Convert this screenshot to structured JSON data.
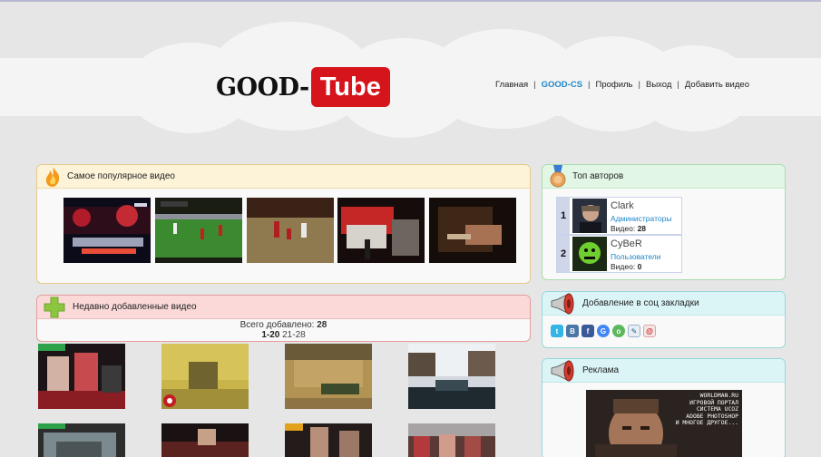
{
  "logo": {
    "part1": "GOOD-",
    "part2": "Tube"
  },
  "nav": [
    {
      "label": "Главная",
      "accent": false
    },
    {
      "label": "GOOD-CS",
      "accent": true
    },
    {
      "label": "Профиль",
      "accent": false
    },
    {
      "label": "Выход",
      "accent": false
    },
    {
      "label": "Добавить видео",
      "accent": false
    }
  ],
  "nav_separator": "|",
  "popular": {
    "title": "Самое популярное видео"
  },
  "recent": {
    "title": "Недавно добавленные видео",
    "total_label": "Всего добавлено:",
    "total_value": "28",
    "page_current": "1-20",
    "page_next": "21-28"
  },
  "top_authors": {
    "title": "Топ авторов",
    "videos_label": "Видео:",
    "items": [
      {
        "rank": "1",
        "name": "Clark",
        "group": "Администраторы",
        "videos": "28"
      },
      {
        "rank": "2",
        "name": "CyBeR",
        "group": "Пользователи",
        "videos": "0"
      }
    ]
  },
  "social": {
    "title": "Добавление в соц закладки",
    "icons": [
      "twitter-icon",
      "vkontakte-icon",
      "facebook-icon",
      "google-icon",
      "odnoklassniki-icon",
      "livejournal-icon",
      "mail-ru-icon"
    ]
  },
  "ads": {
    "title": "Реклама",
    "banner_text": "WORLDMAN.RU\nИГРОВОЙ ПОРТАЛ\nСИСТЕМА UCOZ\nADOBE PHOTOSHOP\nИ МНОГОЕ ДРУГОЕ..."
  },
  "colors": {
    "brand_red": "#d5141c",
    "link_blue": "#1e87c8",
    "popular_head": "#fdf3d8",
    "recent_head": "#fbd9d9",
    "top_head": "#e1f6e4",
    "social_head": "#dbf5f7"
  }
}
